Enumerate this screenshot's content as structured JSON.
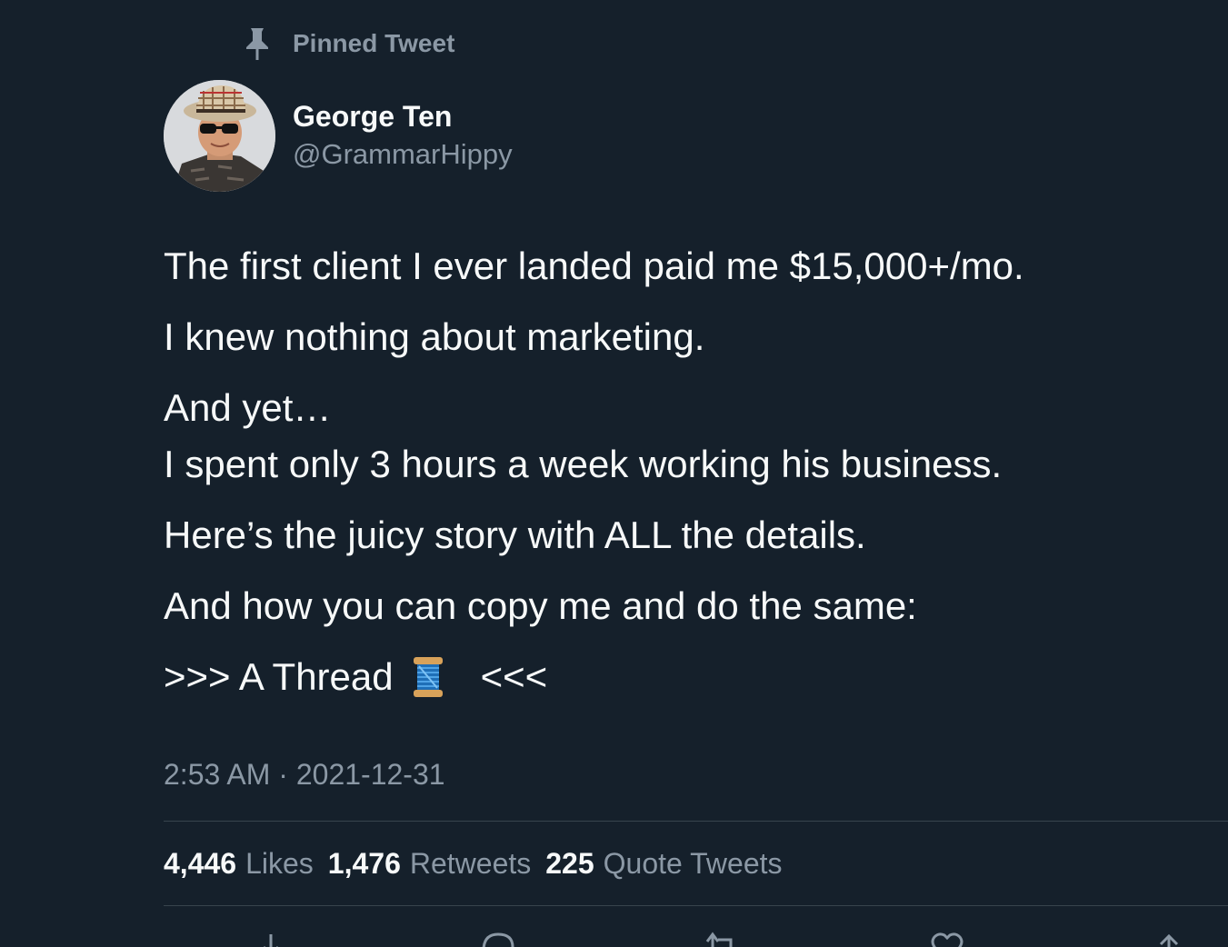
{
  "pinned": {
    "label": "Pinned Tweet",
    "icon": "pin-icon"
  },
  "author": {
    "name": "George Ten",
    "handle": "@GrammarHippy",
    "avatar_icon": "avatar"
  },
  "tweet": {
    "line1": "The first client I ever landed paid me $15,000+/mo.",
    "line2": "I knew nothing about marketing.",
    "line3a": "And yet…",
    "line3b": "I spent only 3 hours a week working his business.",
    "line4": "Here’s the juicy story with ALL the details.",
    "line5": "And how you can copy me and do the same:",
    "thread_prefix": ">>> A Thread",
    "thread_emoji": "spool-of-thread-icon",
    "thread_suffix": "<<<"
  },
  "meta": {
    "timestamp": "2:53 AM · 2021-12-31"
  },
  "stats": {
    "likes_count": "4,446",
    "likes_label": "Likes",
    "retweets_count": "1,476",
    "retweets_label": "Retweets",
    "quotes_count": "225",
    "quotes_label": "Quote Tweets"
  },
  "actions": [
    "reply-icon",
    "comment-icon",
    "retweet-icon",
    "like-icon",
    "share-icon"
  ],
  "colors": {
    "background": "#15202b",
    "primary_text": "#f7f9f9",
    "secondary_text": "#8b98a5",
    "divider": "#38444d"
  }
}
